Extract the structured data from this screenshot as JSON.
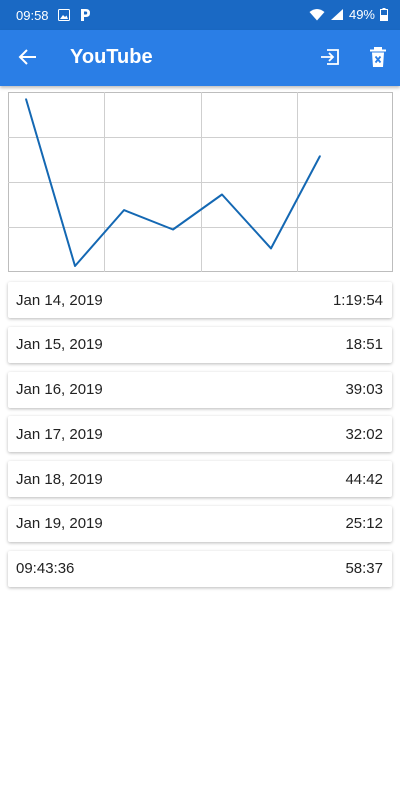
{
  "status_bar": {
    "time": "09:58",
    "battery": "49%"
  },
  "app_bar": {
    "title": "YouTube"
  },
  "colors": {
    "status_bar": "#1a69c4",
    "app_bar": "#2a7ee6",
    "chart_line": "#1468b3"
  },
  "chart_data": {
    "type": "line",
    "x": [
      "Jan 14, 2019",
      "Jan 15, 2019",
      "Jan 16, 2019",
      "Jan 17, 2019",
      "Jan 18, 2019",
      "Jan 19, 2019",
      "09:43:36"
    ],
    "values": [
      4754,
      1131,
      2343,
      1922,
      2682,
      1512,
      3517
    ],
    "title": "",
    "xlabel": "",
    "ylabel": "",
    "grid": true,
    "legend": "none"
  },
  "sessions": [
    {
      "date": "Jan 14, 2019",
      "duration": "1:19:54"
    },
    {
      "date": "Jan 15, 2019",
      "duration": "18:51"
    },
    {
      "date": "Jan 16, 2019",
      "duration": "39:03"
    },
    {
      "date": "Jan 17, 2019",
      "duration": "32:02"
    },
    {
      "date": "Jan 18, 2019",
      "duration": "44:42"
    },
    {
      "date": "Jan 19, 2019",
      "duration": "25:12"
    },
    {
      "date": "09:43:36",
      "duration": "58:37"
    }
  ]
}
